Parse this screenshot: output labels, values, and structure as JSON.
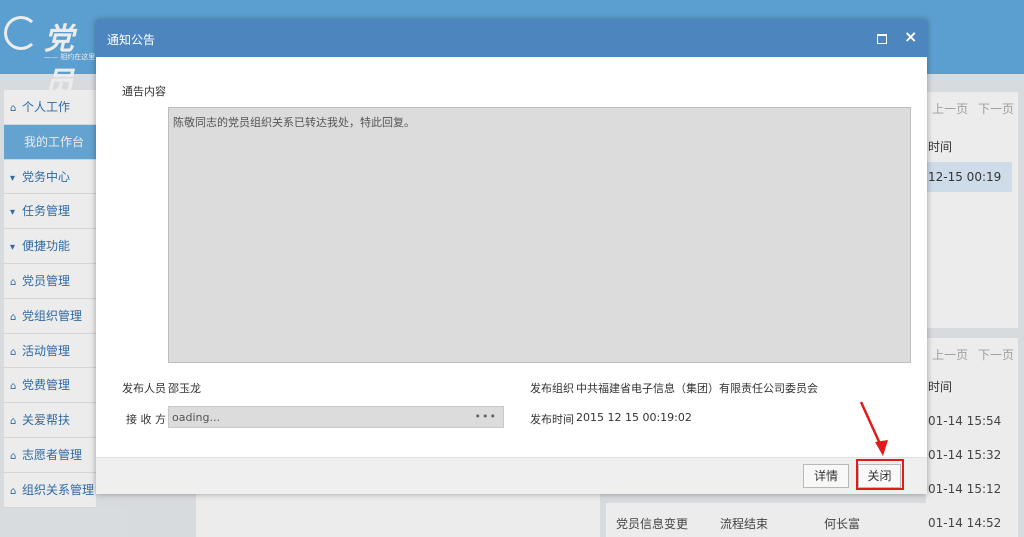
{
  "app": {
    "logo": {
      "text": "党员",
      "sub": "—— 相约在这里"
    },
    "sidebar": {
      "items": [
        {
          "icon": "home-icon",
          "label": "个人工作"
        },
        {
          "icon": "",
          "label": "我的工作台",
          "active": true
        },
        {
          "icon": "caret-down-icon",
          "label": "党务中心"
        },
        {
          "icon": "caret-down-icon",
          "label": "任务管理"
        },
        {
          "icon": "caret-down-icon",
          "label": "便捷功能"
        },
        {
          "icon": "home-icon",
          "label": "党员管理"
        },
        {
          "icon": "home-icon",
          "label": "党组织管理"
        },
        {
          "icon": "home-icon",
          "label": "活动管理"
        },
        {
          "icon": "home-icon",
          "label": "党费管理"
        },
        {
          "icon": "home-icon",
          "label": "关爱帮扶"
        },
        {
          "icon": "home-icon",
          "label": "志愿者管理"
        },
        {
          "icon": "home-icon",
          "label": "组织关系管理"
        }
      ]
    },
    "right_panel_top": {
      "prev": "上一页",
      "next": "下一页",
      "col_time": "时间",
      "row_time": "12-15 00:19"
    },
    "right_panel_bottom": {
      "prev": "上一页",
      "next": "下一页",
      "col_time": "时间",
      "rows": [
        "01-14 15:54",
        "01-14 15:32",
        "01-14 15:12",
        "01-14 14:52"
      ]
    },
    "bottom_row": {
      "col1": "党员信息变更",
      "col2": "流程结束",
      "col3": "何长富"
    }
  },
  "modal": {
    "title": "通知公告",
    "content_label": "通告内容",
    "content_text": "陈敬同志的党员组织关系已转达我处，特此回复。",
    "publisher_label": "发布人员",
    "publisher_value": "邵玉龙",
    "org_label": "发布组织",
    "org_value": "中共福建省电子信息（集团）有限责任公司委员会",
    "receiver_label": "接 收 方",
    "receiver_value": "oading...",
    "receiver_button": "•••",
    "time_label": "发布时间",
    "time_value": "2015 12 15 00:19:02",
    "detail_button": "详情",
    "close_button": "关闭",
    "maximize_icon": "maximize-icon",
    "close_icon": "close-icon"
  },
  "annotation": {
    "highlight_color": "#e01b1b",
    "arrow_color": "#e01b1b"
  }
}
